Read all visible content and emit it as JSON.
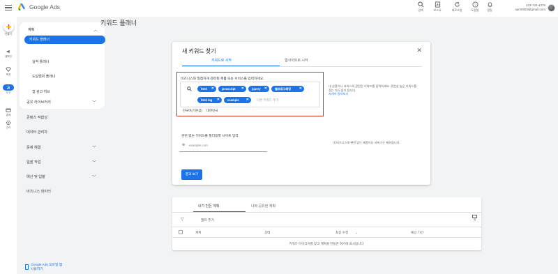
{
  "app": {
    "brand": "Google Ads"
  },
  "topbar": {
    "tools": [
      {
        "label": "검색",
        "icon": "search-icon"
      },
      {
        "label": "보고서",
        "icon": "reports-icon"
      },
      {
        "label": "새로고침",
        "icon": "refresh-icon"
      },
      {
        "label": "도움말",
        "icon": "help-icon"
      },
      {
        "label": "알림",
        "icon": "bell-icon"
      }
    ],
    "account_id": "423-742-4375",
    "account_email": "sprint903@gmail.com"
  },
  "rail": {
    "items": [
      {
        "label": "만들기",
        "icon": "create-plus-icon"
      },
      {
        "label": "캠페인",
        "icon": "campaign-icon"
      },
      {
        "label": "목표",
        "icon": "goals-icon"
      },
      {
        "label": "도구",
        "icon": "tools-icon"
      },
      {
        "label": "결제",
        "icon": "billing-icon"
      },
      {
        "label": "관리",
        "icon": "admin-icon"
      }
    ]
  },
  "sidenav": {
    "section": "계획",
    "selected": "키워드 플래너",
    "sub_items": [
      "실적 플래너",
      "도달범위 플래너",
      "앱 광고 허브"
    ],
    "rows": [
      {
        "label": "공유 라이브러리",
        "chev": true
      },
      {
        "label": "콘텐츠 적합성",
        "chev": false
      },
      {
        "label": "데이터 관리자",
        "chev": false
      },
      {
        "label": "문제 해결",
        "chev": true
      },
      {
        "label": "일괄 작업",
        "chev": true
      },
      {
        "label": "예산 및 입찰",
        "chev": true
      },
      {
        "label": "비즈니스 데이터",
        "chev": false
      }
    ],
    "promo_line1": "Google Ads 모바일 앱",
    "promo_line2": "사용하기"
  },
  "main": {
    "title": "키워드 플래너"
  },
  "dialog": {
    "title": "새 키워드 찾기",
    "close": "✕",
    "tab_keywords": "키워드로 시작",
    "tab_website": "웹사이트로 시작",
    "prompt": "비즈니스와 밀접하게 관련된 제품 또는 서비스를 입력하세요.",
    "chips": [
      "html",
      "javascript",
      "jquery",
      "웹프로그래밍",
      "html tag",
      "example"
    ],
    "add_placeholder": "다른 키워드 추가",
    "location": "한국어(기본값)",
    "location2": "대한민국",
    "side_note": "내 상품이나 서비스와 관련된 키워드를 입력하세요. 관련성 높은 키워드를 찾는 데 도움이 됩니다.",
    "side_link": "자세히 알아보기",
    "url_label": "관련 없는 키워드를 필터링할 사이트 입력",
    "url_placeholder": "example.com",
    "url_note": "내 비즈니스에 관련 없는 제품이나 서비스는 제외됩니다.",
    "result_button": "결과 보기"
  },
  "panel": {
    "tab_plan": "내가 만든 계획",
    "tab_shared": "나와 공유된 계획",
    "filter_label": "필터 추가",
    "columns_label": "열",
    "headers": [
      "계획",
      "상태",
      "최종 수정",
      "예상 기간"
    ],
    "empty_text": "키워드 아이디어를 찾고 계획을 만들면 여기에 표시됩니다."
  },
  "colors": {
    "accent": "#1a73e8",
    "highlight_box": "#d93025"
  }
}
